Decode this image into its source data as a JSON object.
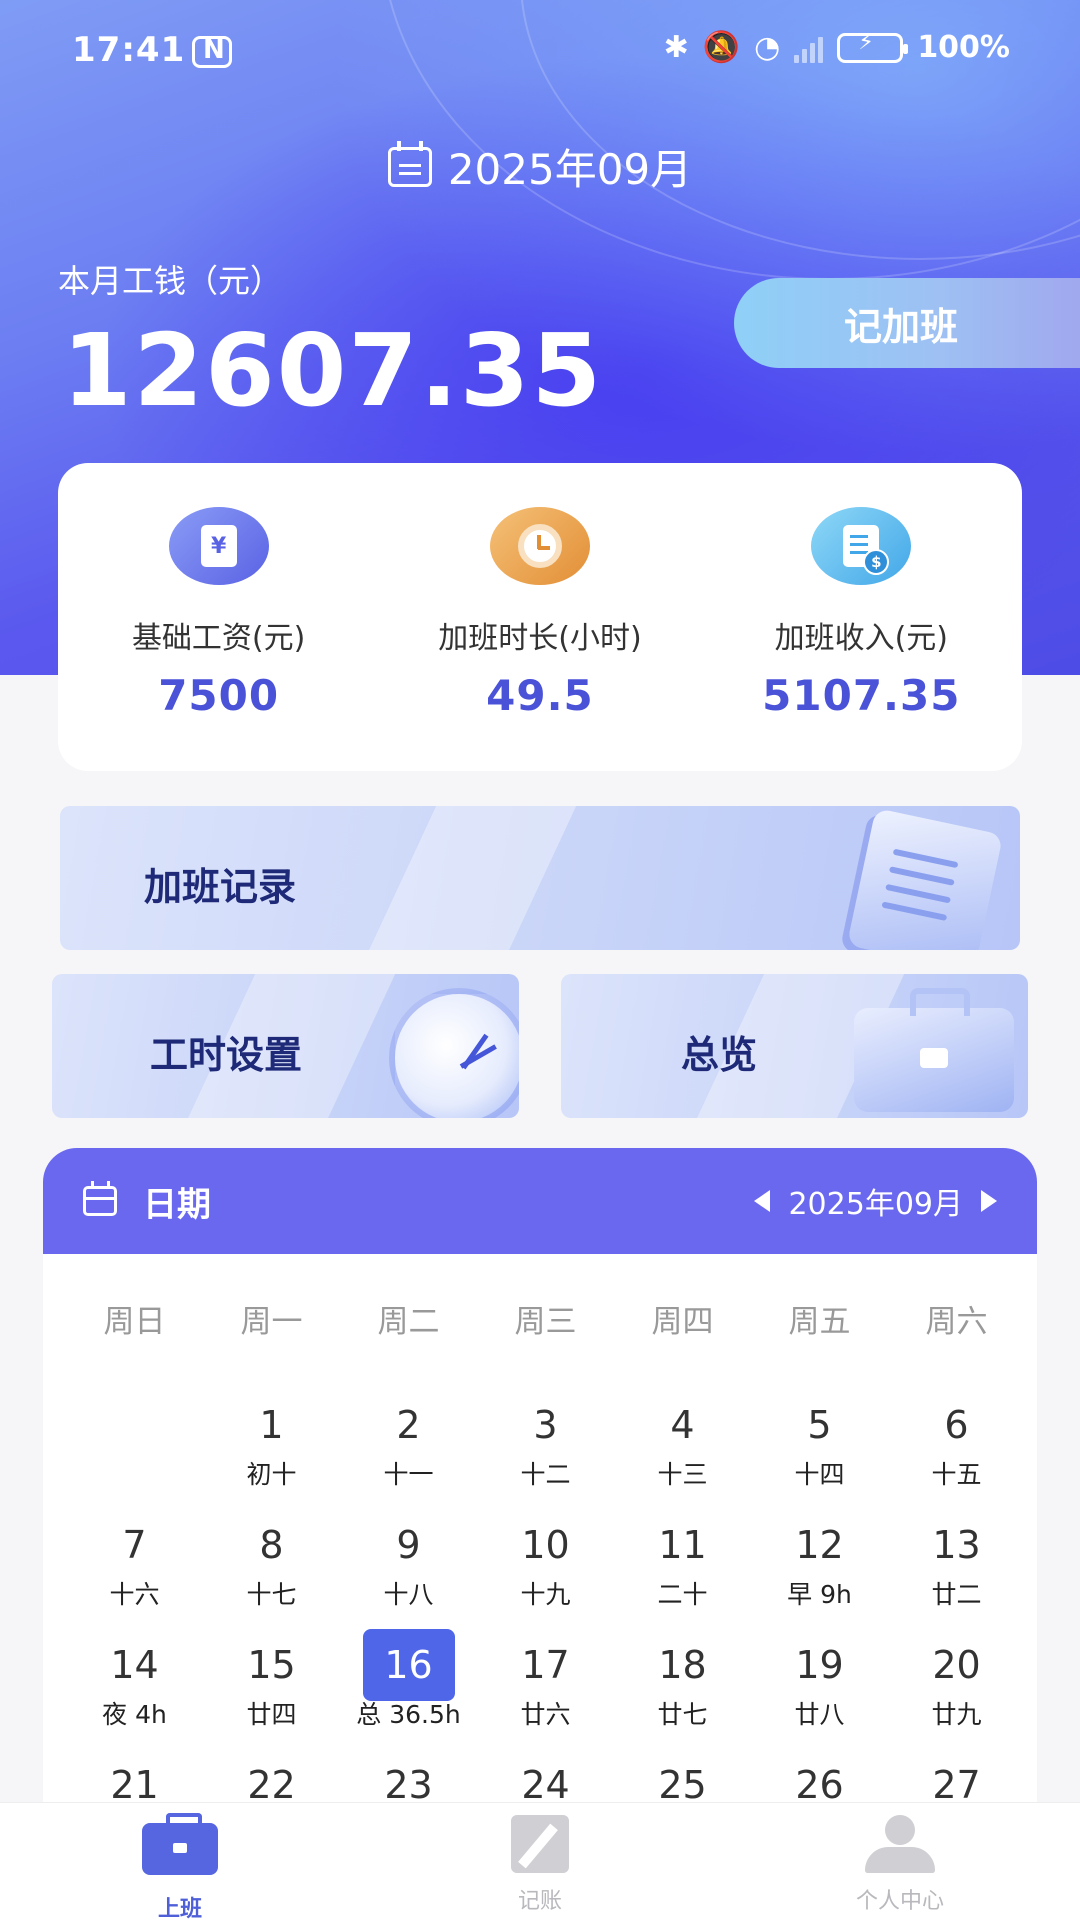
{
  "status_bar": {
    "time": "17:41",
    "battery": "100%"
  },
  "header": {
    "month": "2025年09月"
  },
  "wage": {
    "label": "本月工钱（元）",
    "value": "12607.35"
  },
  "overtime_button": "记加班",
  "stats": [
    {
      "label": "基础工资(元)",
      "value": "7500",
      "icon": "yen-document-icon"
    },
    {
      "label": "加班时长(小时)",
      "value": "49.5",
      "icon": "clock-icon"
    },
    {
      "label": "加班收入(元)",
      "value": "5107.35",
      "icon": "invoice-dollar-icon"
    }
  ],
  "features": {
    "record": "加班记录",
    "hours": "工时设置",
    "overview": "总览"
  },
  "calendar": {
    "title": "日期",
    "month": "2025年09月",
    "weekdays": [
      "周日",
      "周一",
      "周二",
      "周三",
      "周四",
      "周五",
      "周六"
    ],
    "days": [
      {
        "num": "1",
        "sub": "初十"
      },
      {
        "num": "2",
        "sub": "十一"
      },
      {
        "num": "3",
        "sub": "十二"
      },
      {
        "num": "4",
        "sub": "十三"
      },
      {
        "num": "5",
        "sub": "十四"
      },
      {
        "num": "6",
        "sub": "十五"
      },
      {
        "num": "7",
        "sub": "十六"
      },
      {
        "num": "8",
        "sub": "十七"
      },
      {
        "num": "9",
        "sub": "十八"
      },
      {
        "num": "10",
        "sub": "十九"
      },
      {
        "num": "11",
        "sub": "二十"
      },
      {
        "num": "12",
        "sub": "早 9h"
      },
      {
        "num": "13",
        "sub": "廿二"
      },
      {
        "num": "14",
        "sub": "夜 4h"
      },
      {
        "num": "15",
        "sub": "廿四"
      },
      {
        "num": "16",
        "sub": "总 36.5h"
      },
      {
        "num": "17",
        "sub": "廿六"
      },
      {
        "num": "18",
        "sub": "廿七"
      },
      {
        "num": "19",
        "sub": "廿八"
      },
      {
        "num": "20",
        "sub": "廿九"
      },
      {
        "num": "21",
        "sub": ""
      },
      {
        "num": "22",
        "sub": ""
      },
      {
        "num": "23",
        "sub": ""
      },
      {
        "num": "24",
        "sub": ""
      },
      {
        "num": "25",
        "sub": ""
      },
      {
        "num": "26",
        "sub": ""
      },
      {
        "num": "27",
        "sub": ""
      }
    ],
    "selected_day": "16"
  },
  "nav": [
    {
      "label": "上班",
      "color": "#4f5fd8",
      "icon": "briefcase-icon"
    },
    {
      "label": "记账",
      "color": "#b8b8bd",
      "icon": "notepad-icon"
    },
    {
      "label": "个人中心",
      "color": "#b8b8bd",
      "icon": "person-icon"
    }
  ]
}
